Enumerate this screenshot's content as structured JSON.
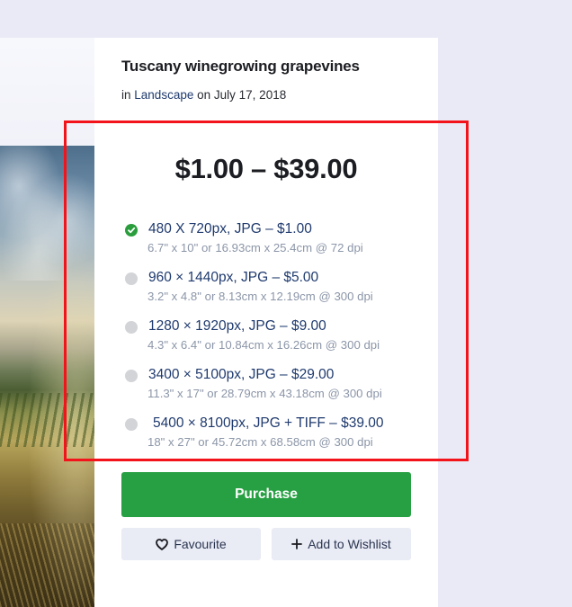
{
  "product": {
    "title": "Tuscany winegrowing grapevines",
    "meta_prefix": "in",
    "category": "Landscape",
    "meta_mid": "on",
    "date": "July 17, 2018"
  },
  "pricing": {
    "range": "$1.00 – $39.00",
    "options": [
      {
        "label": "480 X 720px, JPG – $1.00",
        "detail": "6.7\" x 10\" or 16.93cm x 25.4cm @ 72 dpi",
        "selected": true
      },
      {
        "label": "960 × 1440px, JPG – $5.00",
        "detail": "3.2\" x 4.8\" or 8.13cm x 12.19cm @ 300 dpi",
        "selected": false
      },
      {
        "label": "1280 × 1920px, JPG – $9.00",
        "detail": "4.3\" x 6.4\" or 10.84cm x 16.26cm @ 300 dpi",
        "selected": false
      },
      {
        "label": "3400 × 5100px, JPG – $29.00",
        "detail": "11.3\" x 17\" or 28.79cm x 43.18cm @ 300 dpi",
        "selected": false
      },
      {
        "label": "5400 × 8100px, JPG + TIFF – $39.00",
        "detail": "18\" x 27\" or 45.72cm x 68.58cm @ 300 dpi",
        "selected": false
      }
    ]
  },
  "actions": {
    "purchase_label": "Purchase",
    "favourite_label": "Favourite",
    "favourite_icon": "heart-icon",
    "wishlist_label": "Add to Wishlist",
    "wishlist_icon": "plus-icon"
  },
  "colors": {
    "purchase_green": "#27a043",
    "selected_check": "#2a9d3c",
    "link_blue": "#1f3a6e",
    "highlight_red": "#f2141a"
  }
}
